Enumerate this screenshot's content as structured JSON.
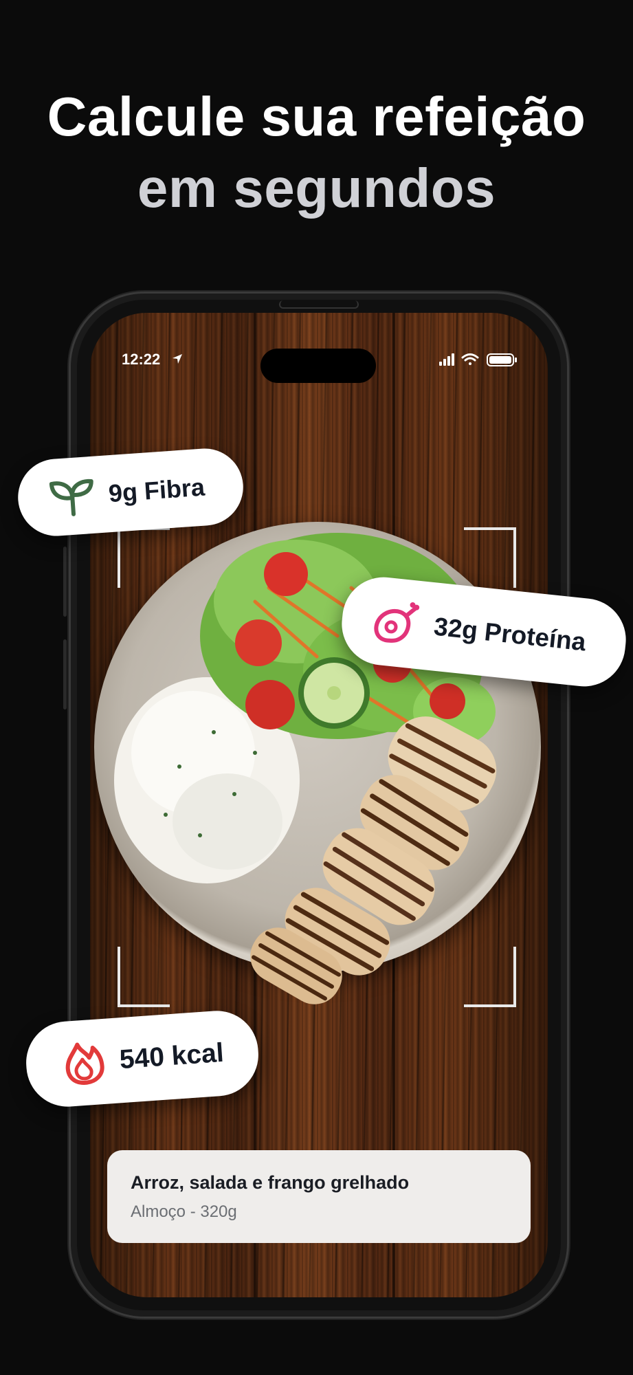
{
  "headline": {
    "line1": "Calcule sua refeição",
    "line2": "em segundos"
  },
  "status_bar": {
    "time": "12:22"
  },
  "badges": {
    "fiber": {
      "label": "9g Fibra",
      "icon": "sprout-icon",
      "color": "#3f6b45"
    },
    "protein": {
      "label": "32g Proteína",
      "icon": "meat-icon",
      "color": "#e2337a"
    },
    "calories": {
      "label": "540 kcal",
      "icon": "flame-icon",
      "color": "#e23a3a"
    }
  },
  "meal_card": {
    "title": "Arroz, salada e frango grelhado",
    "subtitle": "Almoço - 320g"
  },
  "colors": {
    "background": "#0b0b0b",
    "headline_primary": "#ffffff",
    "headline_secondary": "#d0d1d6"
  }
}
